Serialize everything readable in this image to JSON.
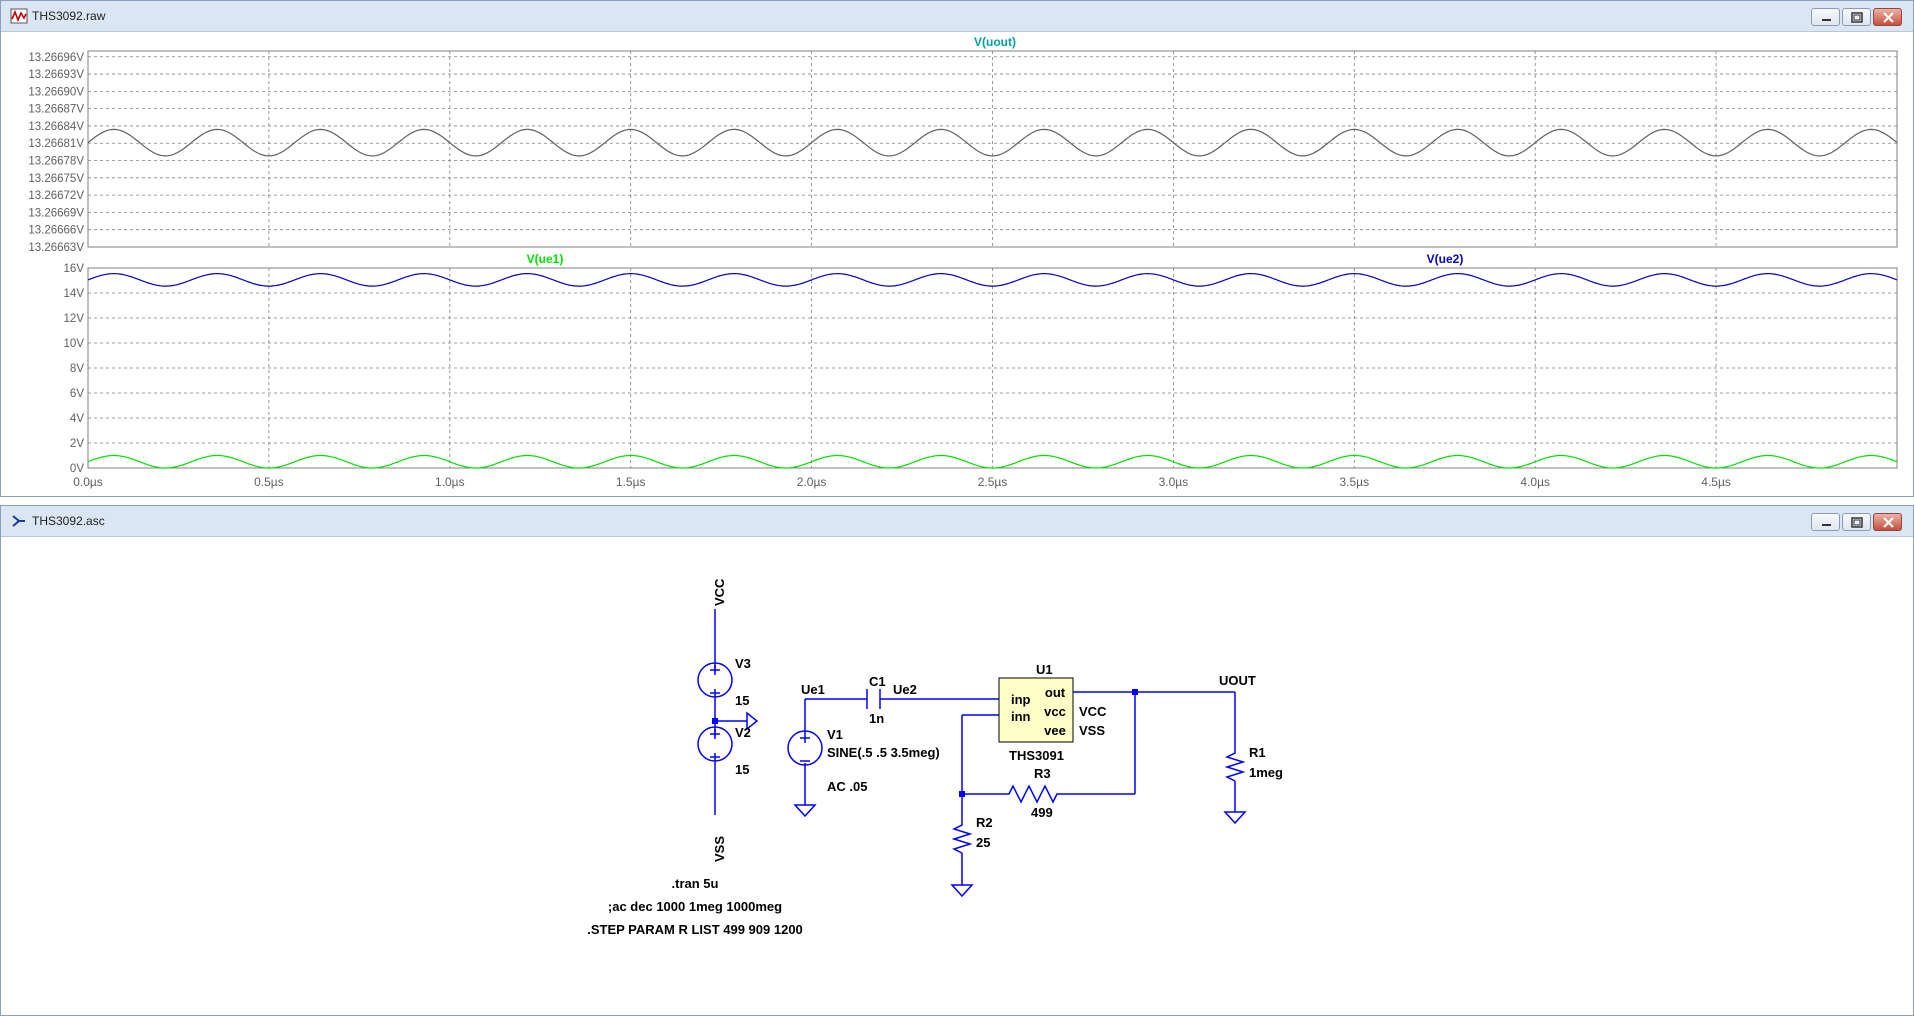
{
  "raw_window": {
    "title": "THS3092.raw",
    "buttons": [
      "minimize",
      "maximize",
      "close"
    ]
  },
  "asc_window": {
    "title": "THS3092.asc",
    "buttons": [
      "minimize",
      "maximize",
      "close"
    ]
  },
  "chart_data": [
    {
      "type": "line",
      "title": "V(uout)",
      "x_unit": "µs",
      "xlim": [
        0,
        5
      ],
      "x_ticks": [
        "0.0µs",
        "0.5µs",
        "1.0µs",
        "1.5µs",
        "2.0µs",
        "2.5µs",
        "3.0µs",
        "3.5µs",
        "4.0µs",
        "4.5µs"
      ],
      "y_ticks": [
        "13.26696V",
        "13.26693V",
        "13.26690V",
        "13.26687V",
        "13.26684V",
        "13.26681V",
        "13.26678V",
        "13.26675V",
        "13.26672V",
        "13.26669V",
        "13.26666V",
        "13.26663V"
      ],
      "ylim": [
        13.26663,
        13.26697
      ],
      "grid": true,
      "series": [
        {
          "name": "V(uout)",
          "color": "#606060",
          "offset": 13.266811,
          "amplitude": 2.3e-05,
          "frequency_mhz": 3.5,
          "phase": 0.0
        }
      ]
    },
    {
      "type": "line",
      "title": "",
      "x_unit": "µs",
      "xlim": [
        0,
        5
      ],
      "y_ticks": [
        "16V",
        "14V",
        "12V",
        "10V",
        "8V",
        "6V",
        "4V",
        "2V",
        "0V"
      ],
      "ylim": [
        0,
        16
      ],
      "grid": true,
      "series": [
        {
          "name": "V(ue1)",
          "color": "#00e000",
          "offset": 0.5,
          "amplitude": 0.5,
          "frequency_mhz": 3.5,
          "phase": 0.0
        },
        {
          "name": "V(ue2)",
          "color": "#0000c8",
          "offset": 15.05,
          "amplitude": 0.5,
          "frequency_mhz": 3.5,
          "phase": 0.0
        }
      ]
    }
  ],
  "schematic": {
    "color_wire": "#0000ff",
    "labels": {
      "vcc": "VCC",
      "vss": "VSS",
      "v3": "V3",
      "v3_val": "15",
      "v2": "V2",
      "v2_val": "15",
      "ue1": "Ue1",
      "ue2": "Ue2",
      "c1": "C1",
      "c1_val": "1n",
      "v1": "V1",
      "v1_val": "SINE(.5 .5 3.5meg)",
      "v1_ac": "AC .05",
      "u1": "U1",
      "u1_model": "THS3091",
      "pin_inp": "inp",
      "pin_inn": "inn",
      "pin_out": "out",
      "pin_vcc": "vcc",
      "pin_vee": "vee",
      "net_vcc": "VCC",
      "net_vss": "VSS",
      "uout": "UOUT",
      "r1": "R1",
      "r1_val": "1meg",
      "r2": "R2",
      "r2_val": "25",
      "r3": "R3",
      "r3_val": "499"
    },
    "directives": [
      ".tran 5u",
      ";ac dec 1000 1meg 1000meg",
      ".STEP PARAM R LIST 499 909 1200"
    ]
  }
}
